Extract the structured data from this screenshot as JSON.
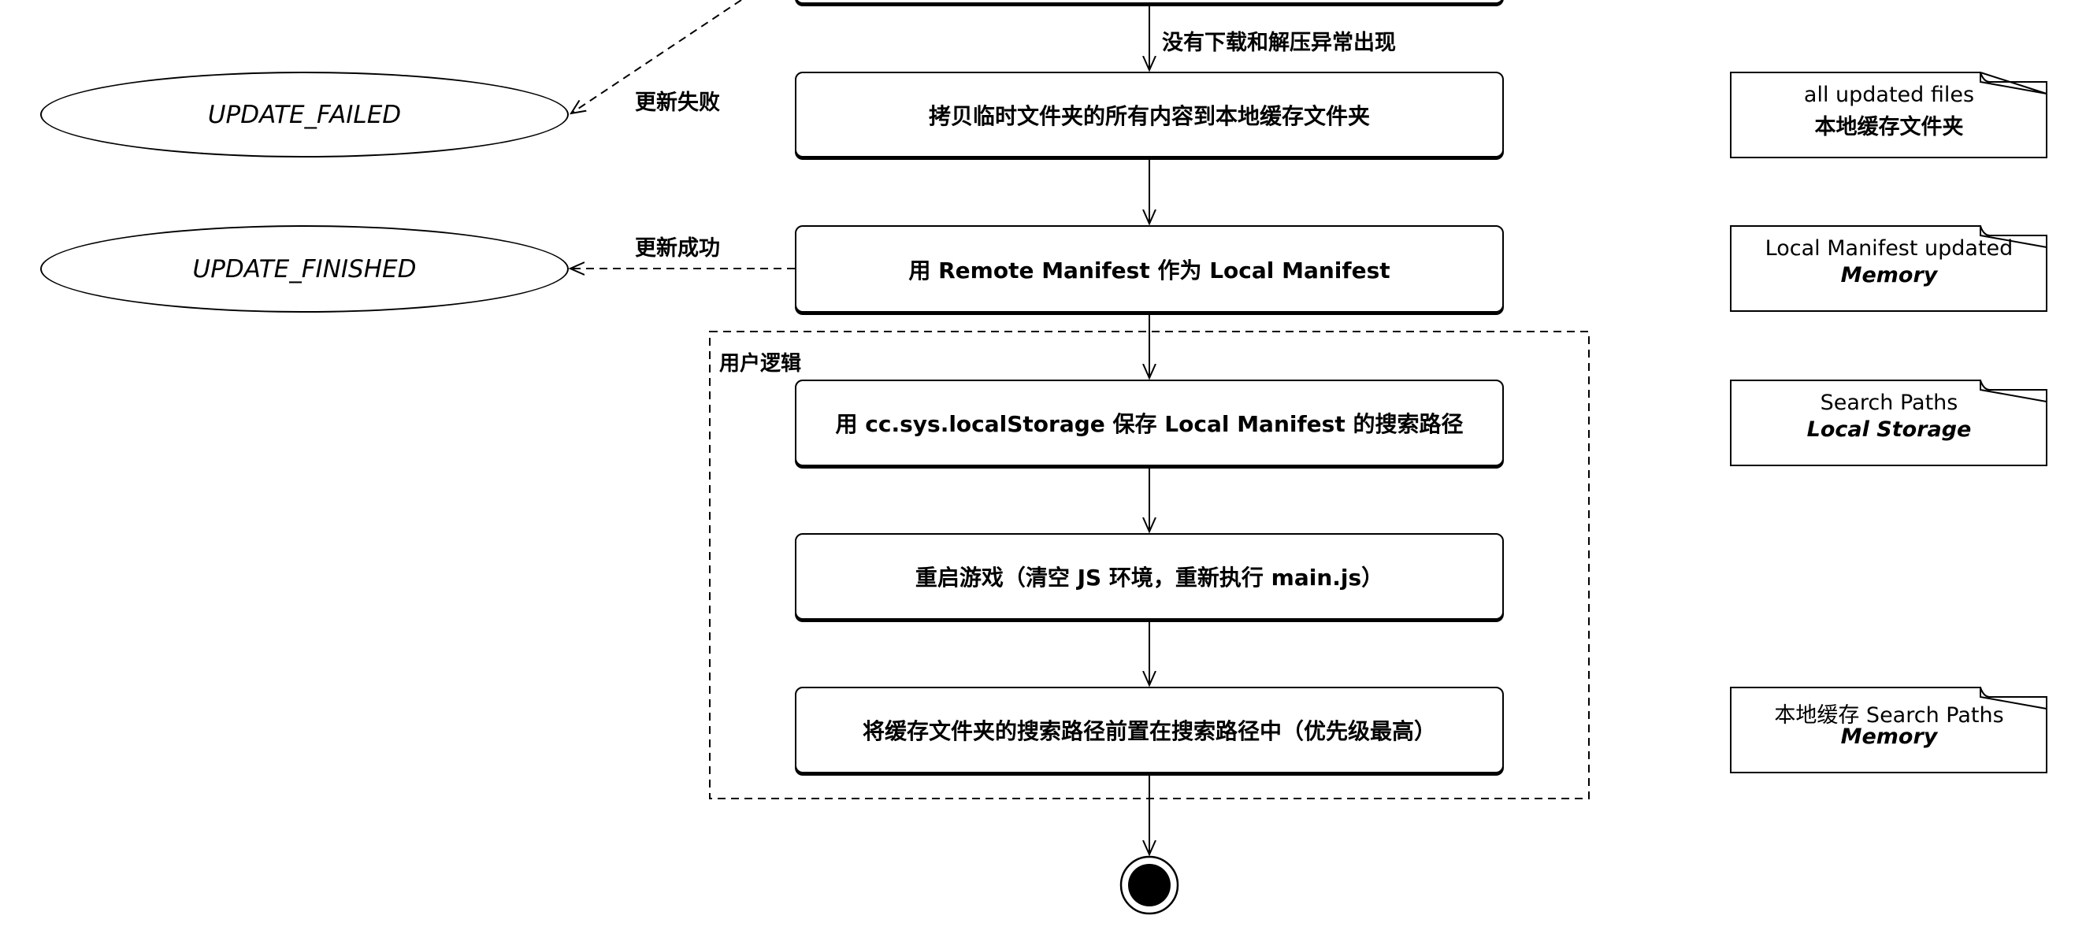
{
  "activities": [
    {
      "id": "copy",
      "label": "拷贝临时文件夹的所有内容到本地缓存文件夹"
    },
    {
      "id": "replace",
      "label": "用 Remote Manifest 作为 Local Manifest"
    },
    {
      "id": "save",
      "label": "用 cc.sys.localStorage 保存 Local Manifest 的搜索路径"
    },
    {
      "id": "restart",
      "label": "重启游戏（清空 JS 环境，重新执行 main.js）"
    },
    {
      "id": "prepend",
      "label": "将缓存文件夹的搜索路径前置在搜索路径中（优先级最高）"
    }
  ],
  "states": {
    "failed": "UPDATE_FAILED",
    "finished": "UPDATE_FINISHED"
  },
  "edge_labels": {
    "no_error": "没有下载和解压异常出现",
    "fail": "更新失败",
    "success": "更新成功"
  },
  "group_label": "用户逻辑",
  "notes": [
    {
      "line1": "all updated files",
      "line2": "本地缓存文件夹"
    },
    {
      "line1": "Local Manifest updated",
      "line2": "Memory"
    },
    {
      "line1": "Search Paths",
      "line2": "Local Storage"
    },
    {
      "line1": "本地缓存 Search Paths",
      "line2": "Memory"
    }
  ]
}
